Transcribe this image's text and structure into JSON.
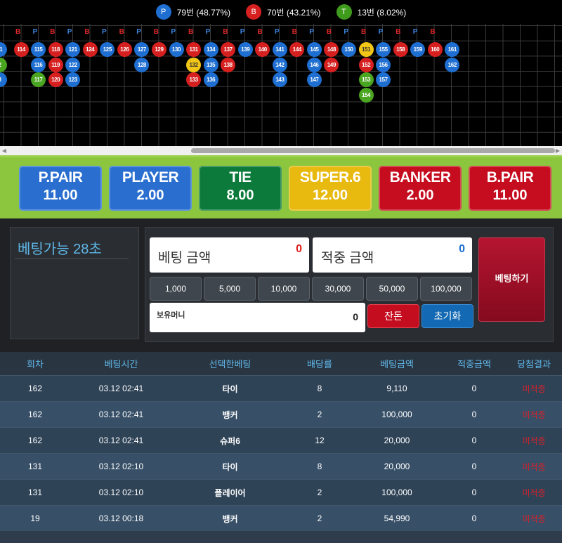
{
  "summary": [
    {
      "letter": "P",
      "text": "79번 (48.77%)",
      "color": "#1e6fd1"
    },
    {
      "letter": "B",
      "text": "70번 (43.21%)",
      "color": "#d62020"
    },
    {
      "letter": "T",
      "text": "13번 (8.02%)",
      "color": "#3f9b1c"
    }
  ],
  "colors": {
    "player": "#1e6fd1",
    "banker": "#d62020",
    "tie": "#4aa520",
    "super6": "#f2c616"
  },
  "road": {
    "headers": [
      "B",
      "P",
      "B",
      "P",
      "B",
      "P",
      "B",
      "P",
      "B",
      "P",
      "B",
      "P",
      "B",
      "P",
      "B",
      "P",
      "B",
      "P",
      "B",
      "P",
      "B",
      "P",
      "B",
      "P",
      "B"
    ],
    "chips": [
      {
        "col": 0,
        "row": 0,
        "label": "11",
        "t": "player",
        "partial": true
      },
      {
        "col": 0,
        "row": 1,
        "label": "2",
        "t": "tie",
        "partial": true
      },
      {
        "col": 0,
        "row": 2,
        "label": "3",
        "t": "player",
        "partial": true
      },
      {
        "col": 1,
        "row": 0,
        "label": "114",
        "t": "banker"
      },
      {
        "col": 2,
        "row": 0,
        "label": "115",
        "t": "player"
      },
      {
        "col": 2,
        "row": 1,
        "label": "116",
        "t": "player"
      },
      {
        "col": 2,
        "row": 2,
        "label": "117",
        "t": "tie"
      },
      {
        "col": 3,
        "row": 0,
        "label": "118",
        "t": "banker"
      },
      {
        "col": 3,
        "row": 1,
        "label": "119",
        "t": "banker"
      },
      {
        "col": 3,
        "row": 2,
        "label": "120",
        "t": "banker"
      },
      {
        "col": 4,
        "row": 0,
        "label": "121",
        "t": "player"
      },
      {
        "col": 4,
        "row": 1,
        "label": "122",
        "t": "player"
      },
      {
        "col": 4,
        "row": 2,
        "label": "123",
        "t": "player"
      },
      {
        "col": 5,
        "row": 0,
        "label": "124",
        "t": "banker"
      },
      {
        "col": 6,
        "row": 0,
        "label": "125",
        "t": "player"
      },
      {
        "col": 7,
        "row": 0,
        "label": "126",
        "t": "banker"
      },
      {
        "col": 8,
        "row": 0,
        "label": "127",
        "t": "player"
      },
      {
        "col": 8,
        "row": 1,
        "label": "128",
        "t": "player"
      },
      {
        "col": 9,
        "row": 0,
        "label": "129",
        "t": "banker"
      },
      {
        "col": 10,
        "row": 0,
        "label": "130",
        "t": "player"
      },
      {
        "col": 11,
        "row": 0,
        "label": "131",
        "t": "banker"
      },
      {
        "col": 11,
        "row": 1,
        "label": "132",
        "t": "super6"
      },
      {
        "col": 11,
        "row": 2,
        "label": "133",
        "t": "banker"
      },
      {
        "col": 12,
        "row": 0,
        "label": "134",
        "t": "player"
      },
      {
        "col": 12,
        "row": 1,
        "label": "135",
        "t": "player"
      },
      {
        "col": 12,
        "row": 2,
        "label": "136",
        "t": "player"
      },
      {
        "col": 13,
        "row": 0,
        "label": "137",
        "t": "banker"
      },
      {
        "col": 13,
        "row": 1,
        "label": "138",
        "t": "banker"
      },
      {
        "col": 14,
        "row": 0,
        "label": "139",
        "t": "player"
      },
      {
        "col": 15,
        "row": 0,
        "label": "140",
        "t": "banker"
      },
      {
        "col": 16,
        "row": 0,
        "label": "141",
        "t": "player"
      },
      {
        "col": 16,
        "row": 1,
        "label": "142",
        "t": "player"
      },
      {
        "col": 16,
        "row": 2,
        "label": "143",
        "t": "player"
      },
      {
        "col": 17,
        "row": 0,
        "label": "144",
        "t": "banker"
      },
      {
        "col": 18,
        "row": 0,
        "label": "145",
        "t": "player"
      },
      {
        "col": 18,
        "row": 1,
        "label": "146",
        "t": "player"
      },
      {
        "col": 18,
        "row": 2,
        "label": "147",
        "t": "player"
      },
      {
        "col": 19,
        "row": 0,
        "label": "148",
        "t": "banker"
      },
      {
        "col": 19,
        "row": 1,
        "label": "149",
        "t": "banker"
      },
      {
        "col": 20,
        "row": 0,
        "label": "150",
        "t": "player"
      },
      {
        "col": 21,
        "row": 0,
        "label": "151",
        "t": "super6"
      },
      {
        "col": 21,
        "row": 1,
        "label": "152",
        "t": "banker"
      },
      {
        "col": 21,
        "row": 2,
        "label": "153",
        "t": "tie"
      },
      {
        "col": 21,
        "row": 3,
        "label": "154",
        "t": "tie"
      },
      {
        "col": 22,
        "row": 0,
        "label": "155",
        "t": "player"
      },
      {
        "col": 22,
        "row": 1,
        "label": "156",
        "t": "player"
      },
      {
        "col": 22,
        "row": 2,
        "label": "157",
        "t": "player"
      },
      {
        "col": 23,
        "row": 0,
        "label": "158",
        "t": "banker"
      },
      {
        "col": 24,
        "row": 0,
        "label": "159",
        "t": "player"
      },
      {
        "col": 25,
        "row": 0,
        "label": "160",
        "t": "banker"
      },
      {
        "col": 26,
        "row": 0,
        "label": "161",
        "t": "player"
      },
      {
        "col": 26,
        "row": 1,
        "label": "162",
        "t": "player"
      }
    ]
  },
  "bets": [
    {
      "name": "P.PAIR",
      "odds": "11.00",
      "color": "#2a6fd0"
    },
    {
      "name": "PLAYER",
      "odds": "2.00",
      "color": "#2a6fd0"
    },
    {
      "name": "TIE",
      "odds": "8.00",
      "color": "#0c7a3a"
    },
    {
      "name": "SUPER.6",
      "odds": "12.00",
      "color": "#e8b90f"
    },
    {
      "name": "BANKER",
      "odds": "2.00",
      "color": "#c60d1f"
    },
    {
      "name": "B.PAIR",
      "odds": "11.00",
      "color": "#c60d1f"
    }
  ],
  "timer": {
    "label": "베팅가능 28초"
  },
  "form": {
    "bet_label": "베팅 금액",
    "bet_value": "0",
    "win_label": "적중 금액",
    "win_value": "0",
    "chips": [
      "1,000",
      "5,000",
      "10,000",
      "30,000",
      "50,000",
      "100,000"
    ],
    "own_label": "보유머니",
    "own_value": "0",
    "remain": "잔돈",
    "reset": "초기화",
    "submit": "베팅하기"
  },
  "table": {
    "headers": [
      "회차",
      "베팅시간",
      "선택한베팅",
      "배당률",
      "베팅금액",
      "적중금액",
      "당첨결과"
    ],
    "rows": [
      [
        "162",
        "03.12 02:41",
        "타이",
        "8",
        "9,110",
        "0",
        "미적중"
      ],
      [
        "162",
        "03.12 02:41",
        "뱅커",
        "2",
        "100,000",
        "0",
        "미적중"
      ],
      [
        "162",
        "03.12 02:41",
        "슈퍼6",
        "12",
        "20,000",
        "0",
        "미적중"
      ],
      [
        "131",
        "03.12 02:10",
        "타이",
        "8",
        "20,000",
        "0",
        "미적중"
      ],
      [
        "131",
        "03.12 02:10",
        "플레이어",
        "2",
        "100,000",
        "0",
        "미적중"
      ],
      [
        "19",
        "03.12 00:18",
        "뱅커",
        "2",
        "54,990",
        "0",
        "미적중"
      ]
    ]
  }
}
